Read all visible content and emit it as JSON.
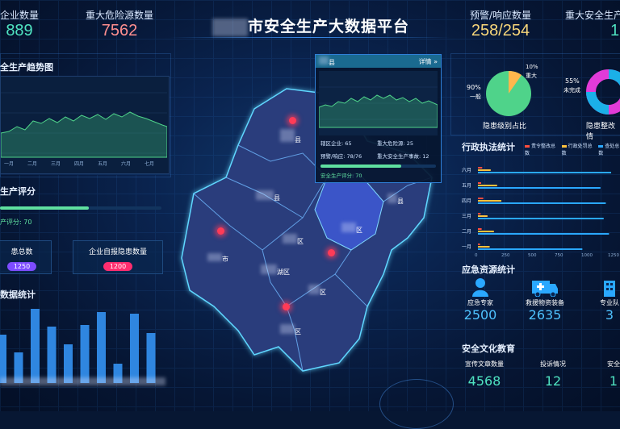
{
  "header": {
    "title": "市安全生产大数据平台",
    "kpis": [
      {
        "label": "企业数量",
        "value": "889"
      },
      {
        "label": "重大危险源数量",
        "value": "7562"
      },
      {
        "label": "预警/响应数量",
        "value": "258/254"
      },
      {
        "label": "重大安全生产",
        "value": "1"
      }
    ]
  },
  "left": {
    "trend_title": "全生产趋势图",
    "trend_months": [
      "一月",
      "二月",
      "三月",
      "四月",
      "五月",
      "六月",
      "七月"
    ],
    "score_title": "生产评分",
    "score_text": "产评分: 70",
    "score_pct": 0.55,
    "cards": [
      {
        "label": "患总数",
        "badge": "1250",
        "color": "#7d4cff"
      },
      {
        "label": "企业自报隐患数量",
        "badge": "1200",
        "color": "#ff2d6f"
      }
    ],
    "bars_title": "数据统计",
    "bars_values": [
      60,
      38,
      92,
      70,
      48,
      72,
      88,
      24,
      86,
      62
    ]
  },
  "popup": {
    "title": "县",
    "detail": "详情 »",
    "stats": [
      {
        "label": "辖区企业: 65",
        "value2": "重大危险源: 25"
      },
      {
        "label": "预警/响应: 78/76",
        "value2": "重大安全生产事故: 12"
      }
    ],
    "score_text": "安全生产评分: 70",
    "score_pct": 0.7
  },
  "map": {
    "labels": [
      "县",
      "县",
      "县",
      "区",
      "区",
      "市",
      "湖区",
      "区",
      "区"
    ]
  },
  "right": {
    "pie1": {
      "pct_small": "10%",
      "label_small": "重大",
      "pct_big": "90%",
      "label_big": "一般",
      "title": "隐患级别占比"
    },
    "pie2": {
      "pct": "55%",
      "label": "未完成",
      "title": "隐患整改情"
    },
    "enforce_title": "行政执法统计",
    "legend": [
      {
        "label": "责令整改总数",
        "color": "#ff4d3d"
      },
      {
        "label": "行政处罚总数",
        "color": "#ffc23d"
      },
      {
        "label": "查处总数",
        "color": "#2aa8ff"
      }
    ],
    "months": [
      "六月",
      "五月",
      "四月",
      "三月",
      "二月",
      "一月"
    ],
    "axis_ticks": [
      "0",
      "250",
      "500",
      "750",
      "1000",
      "1250"
    ],
    "enforce_rows": [
      {
        "red": 40,
        "yellow": 120,
        "blue": 1250
      },
      {
        "red": 30,
        "yellow": 180,
        "blue": 1150
      },
      {
        "red": 50,
        "yellow": 220,
        "blue": 1200
      },
      {
        "red": 25,
        "yellow": 90,
        "blue": 1180
      },
      {
        "red": 35,
        "yellow": 150,
        "blue": 1230
      },
      {
        "red": 20,
        "yellow": 110,
        "blue": 980
      }
    ],
    "emergency_title": "应急资源统计",
    "emergency": [
      {
        "label": "应急专家",
        "value": "2500",
        "icon": "expert-icon"
      },
      {
        "label": "救援物资装备",
        "value": "2635",
        "icon": "ambulance-icon"
      },
      {
        "label": "专业队",
        "value": "3",
        "icon": "building-icon"
      }
    ],
    "culture_title": "安全文化教育",
    "culture": [
      {
        "label": "宣传文章数量",
        "value": "4568"
      },
      {
        "label": "投诉情况",
        "value": "12"
      },
      {
        "label": "安全",
        "value": "1"
      }
    ]
  }
}
